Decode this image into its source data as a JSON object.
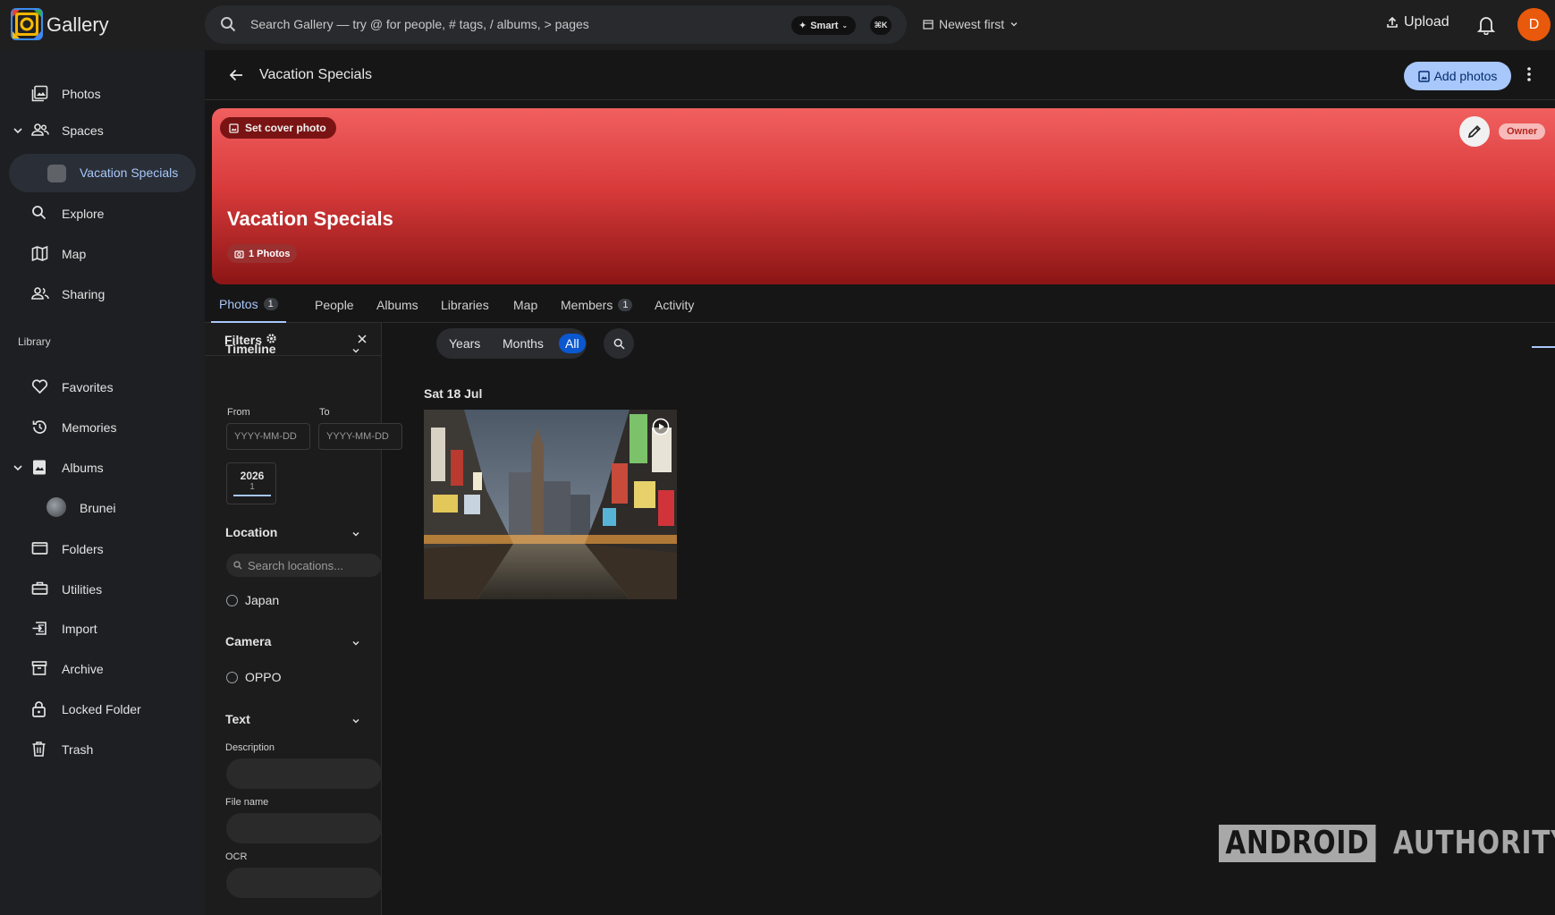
{
  "app": {
    "brand": "Gallery"
  },
  "topbar": {
    "search_placeholder": "Search Gallery — try @ for people, # tags, / albums, > pages",
    "smart_label": "Smart",
    "kbd_label": "⌘K",
    "sort_label": "Newest first",
    "upload_label": "Upload",
    "avatar_initial": "D"
  },
  "sidebar": {
    "photos": "Photos",
    "spaces": "Spaces",
    "vacation_specials": "Vacation Specials",
    "explore": "Explore",
    "map": "Map",
    "sharing": "Sharing",
    "library_label": "Library",
    "favorites": "Favorites",
    "memories": "Memories",
    "albums": "Albums",
    "brunei": "Brunei",
    "folders": "Folders",
    "utilities": "Utilities",
    "import": "Import",
    "archive": "Archive",
    "locked_folder": "Locked Folder",
    "trash": "Trash"
  },
  "header": {
    "title": "Vacation Specials",
    "add_photos": "Add photos"
  },
  "cover": {
    "set_cover": "Set cover photo",
    "owner": "Owner",
    "title": "Vacation Specials",
    "photo_count": "1 Photos",
    "gradient_top": "#f15f5f",
    "gradient_bottom": "#8c1515"
  },
  "tabs": [
    {
      "label": "Photos",
      "count": "1"
    },
    {
      "label": "People"
    },
    {
      "label": "Albums"
    },
    {
      "label": "Libraries"
    },
    {
      "label": "Map"
    },
    {
      "label": "Members",
      "count": "1"
    },
    {
      "label": "Activity"
    }
  ],
  "filters": {
    "title": "Filters",
    "timeline": "Timeline",
    "from": "From",
    "to": "To",
    "date_placeholder": "YYYY-MM-DD",
    "year": "2026",
    "year_count": "1",
    "location": "Location",
    "location_placeholder": "Search locations...",
    "location_option": "Japan",
    "camera": "Camera",
    "camera_option": "OPPO",
    "text": "Text",
    "description": "Description",
    "file_name": "File name",
    "ocr": "OCR"
  },
  "view": {
    "years": "Years",
    "months": "Months",
    "all": "All"
  },
  "grid": {
    "date_heading": "Sat 18 Jul"
  },
  "watermark": {
    "left": "ANDROID",
    "right": "AUTHORITY"
  },
  "colors": {
    "accent": "#a8c7fa",
    "primary_button": "#0b57d0",
    "avatar": "#e8590c"
  }
}
